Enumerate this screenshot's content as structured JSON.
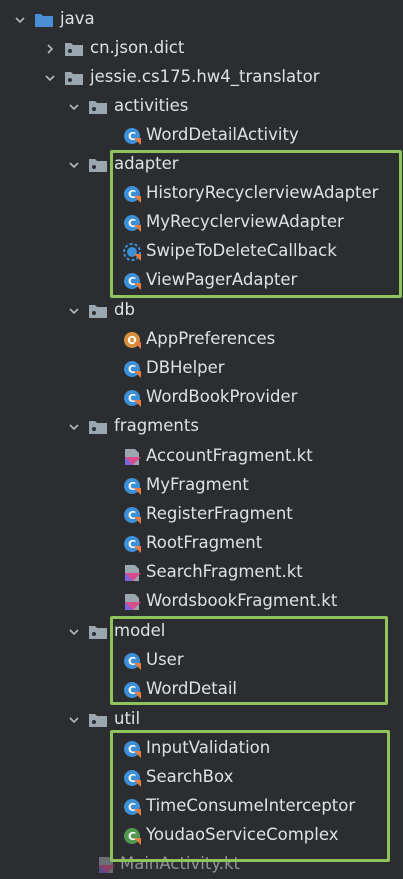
{
  "colors": {
    "background": "#2b2d30",
    "text": "#dfe1e5",
    "folder": "#9aa7b0",
    "java_folder": "#4a8fd6",
    "class_icon": "#3d8fd8",
    "interface_icon": "#3d8fd8",
    "abstract_icon": "#d9903d",
    "service_icon": "#4f9a4f",
    "highlight": "#8fc45c"
  },
  "tree": [
    {
      "label": "java",
      "type": "java-folder",
      "expanded": true
    },
    {
      "label": "cn.json.dict",
      "type": "package",
      "expanded": false
    },
    {
      "label": "jessie.cs175.hw4_translator",
      "type": "package",
      "expanded": true
    },
    {
      "label": "activities",
      "type": "package",
      "expanded": true
    },
    {
      "label": "WordDetailActivity",
      "type": "class"
    },
    {
      "label": "adapter",
      "type": "package",
      "expanded": true
    },
    {
      "label": "HistoryRecyclerviewAdapter",
      "type": "class"
    },
    {
      "label": "MyRecyclerviewAdapter",
      "type": "class"
    },
    {
      "label": "SwipeToDeleteCallback",
      "type": "abstract-class"
    },
    {
      "label": "ViewPagerAdapter",
      "type": "class"
    },
    {
      "label": "db",
      "type": "package",
      "expanded": true
    },
    {
      "label": "AppPreferences",
      "type": "object-class"
    },
    {
      "label": "DBHelper",
      "type": "class"
    },
    {
      "label": "WordBookProvider",
      "type": "class"
    },
    {
      "label": "fragments",
      "type": "package",
      "expanded": true
    },
    {
      "label": "AccountFragment.kt",
      "type": "kotlin-file"
    },
    {
      "label": "MyFragment",
      "type": "class"
    },
    {
      "label": "RegisterFragment",
      "type": "class"
    },
    {
      "label": "RootFragment",
      "type": "class"
    },
    {
      "label": "SearchFragment.kt",
      "type": "kotlin-file"
    },
    {
      "label": "WordsbookFragment.kt",
      "type": "kotlin-file"
    },
    {
      "label": "model",
      "type": "package",
      "expanded": true
    },
    {
      "label": "User",
      "type": "class"
    },
    {
      "label": "WordDetail",
      "type": "class"
    },
    {
      "label": "util",
      "type": "package",
      "expanded": true
    },
    {
      "label": "InputValidation",
      "type": "class"
    },
    {
      "label": "SearchBox",
      "type": "class"
    },
    {
      "label": "TimeConsumeInterceptor",
      "type": "class"
    },
    {
      "label": "YoudaoServiceComplex",
      "type": "service-class"
    },
    {
      "label": "MainActivity.kt",
      "type": "kotlin-file"
    }
  ]
}
